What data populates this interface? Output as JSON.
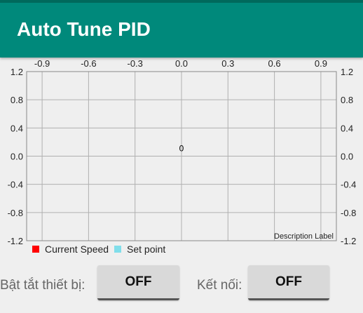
{
  "app": {
    "title": "Auto Tune PID"
  },
  "chart_data": {
    "type": "line",
    "x_ticks": [
      "-0.9",
      "-0.6",
      "-0.3",
      "0.0",
      "0.3",
      "0.6",
      "0.9"
    ],
    "y_ticks": [
      "1.2",
      "0.8",
      "0.4",
      "0.0",
      "-0.4",
      "-0.8",
      "-1.2"
    ],
    "xlim": [
      -1.0,
      1.0
    ],
    "ylim": [
      -1.2,
      1.2
    ],
    "grid": true,
    "series": [
      {
        "name": "Current Speed",
        "color": "#ff0000",
        "points": []
      },
      {
        "name": "Set point",
        "color": "#80deea",
        "points": []
      }
    ],
    "annotation": {
      "text": "0",
      "x": 0.0,
      "y": 0.07
    },
    "description": "Description Label",
    "legend_position": "bottom-left"
  },
  "controls": {
    "device_label": "Bật tắt thiết bị:",
    "device_button": "OFF",
    "connect_label": "Kết nối:",
    "connect_button": "OFF"
  }
}
